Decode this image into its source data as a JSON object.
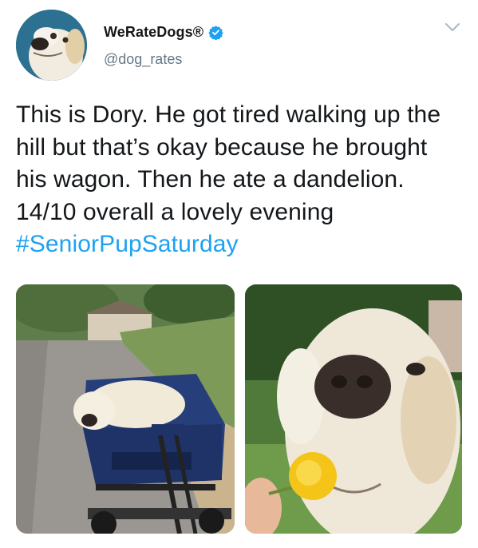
{
  "user": {
    "display_name": "WeRateDogs®",
    "handle": "@dog_rates",
    "verified": true,
    "avatar_icon": "dog-avatar"
  },
  "tweet": {
    "text": "This is Dory. He got tired walking up the hill but that’s okay because he brought his wagon. Then he ate a dandelion. 14/10 overall a lovely evening ",
    "hashtag": "#SeniorPupSaturday"
  },
  "media": [
    {
      "description_icon": "dog-in-wagon-photo"
    },
    {
      "description_icon": "dog-with-dandelion-photo"
    }
  ],
  "colors": {
    "text": "#14171a",
    "secondary": "#657786",
    "accent": "#1da1f2",
    "background": "#ffffff"
  }
}
